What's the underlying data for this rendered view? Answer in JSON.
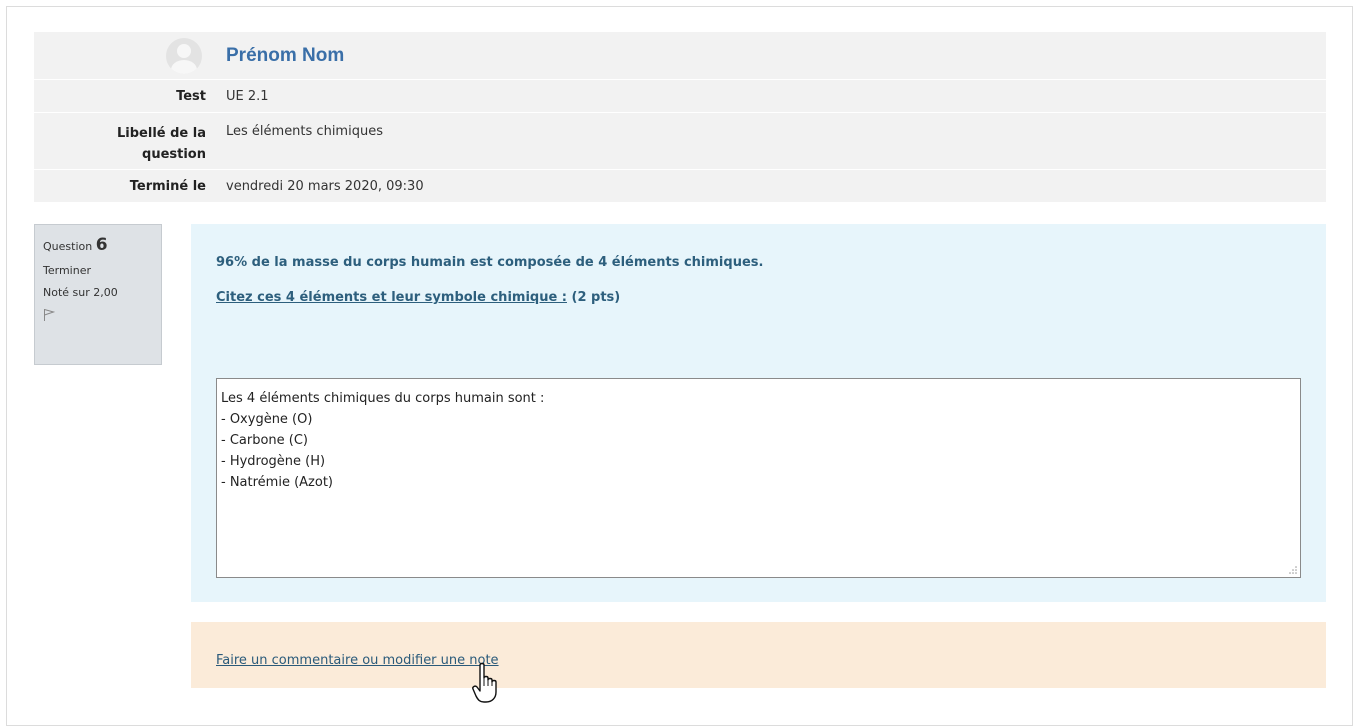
{
  "summary": {
    "name": "Prénom Nom",
    "test_label": "Test",
    "test_value": "UE 2.1",
    "question_label": "Libellé de la question",
    "question_label_line1": "Libellé de la",
    "question_label_line2": "question",
    "question_value": "Les éléments chimiques",
    "finished_label": "Terminé le",
    "finished_value": "vendredi 20 mars 2020, 09:30"
  },
  "question_info": {
    "prefix": "Question",
    "number": "6",
    "status": "Terminer",
    "grade": "Noté sur 2,00",
    "icon": "flag-icon"
  },
  "question": {
    "intro": "96% de la masse du corps humain est composée de 4 éléments chimiques.",
    "prompt_link": "Citez ces 4 éléments et leur symbole chimique :",
    "prompt_points": " (2 pts)",
    "answer_lines": [
      "Les 4 éléments chimiques du corps humain sont :",
      "",
      "- Oxygène (O)",
      "- Carbone (C)",
      "- Hydrogène (H)",
      "- Natrémie (Azot)"
    ]
  },
  "comment": {
    "link": "Faire un commentaire ou modifier une note"
  },
  "colors": {
    "name": "#3a6fa8",
    "question_bg": "#e7f5fb",
    "comment_bg": "#fbebd9",
    "info_bg": "#dee2e6"
  }
}
